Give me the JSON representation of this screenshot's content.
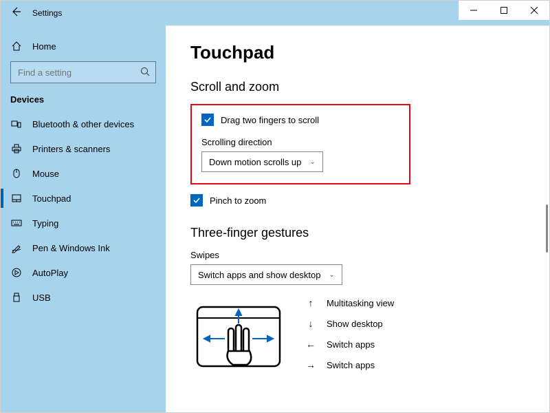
{
  "window": {
    "title": "Settings"
  },
  "sidebar": {
    "home": "Home",
    "search_placeholder": "Find a setting",
    "category": "Devices",
    "items": [
      {
        "label": "Bluetooth & other devices"
      },
      {
        "label": "Printers & scanners"
      },
      {
        "label": "Mouse"
      },
      {
        "label": "Touchpad"
      },
      {
        "label": "Typing"
      },
      {
        "label": "Pen & Windows Ink"
      },
      {
        "label": "AutoPlay"
      },
      {
        "label": "USB"
      }
    ]
  },
  "main": {
    "page_title": "Touchpad",
    "scroll_zoom": {
      "heading": "Scroll and zoom",
      "drag_two_fingers": "Drag two fingers to scroll",
      "scroll_direction_label": "Scrolling direction",
      "scroll_direction_value": "Down motion scrolls up",
      "pinch_to_zoom": "Pinch to zoom"
    },
    "three_finger": {
      "heading": "Three-finger gestures",
      "swipes_label": "Swipes",
      "swipes_value": "Switch apps and show desktop",
      "directions": {
        "up": "Multitasking view",
        "down": "Show desktop",
        "left": "Switch apps",
        "right": "Switch apps"
      }
    }
  }
}
